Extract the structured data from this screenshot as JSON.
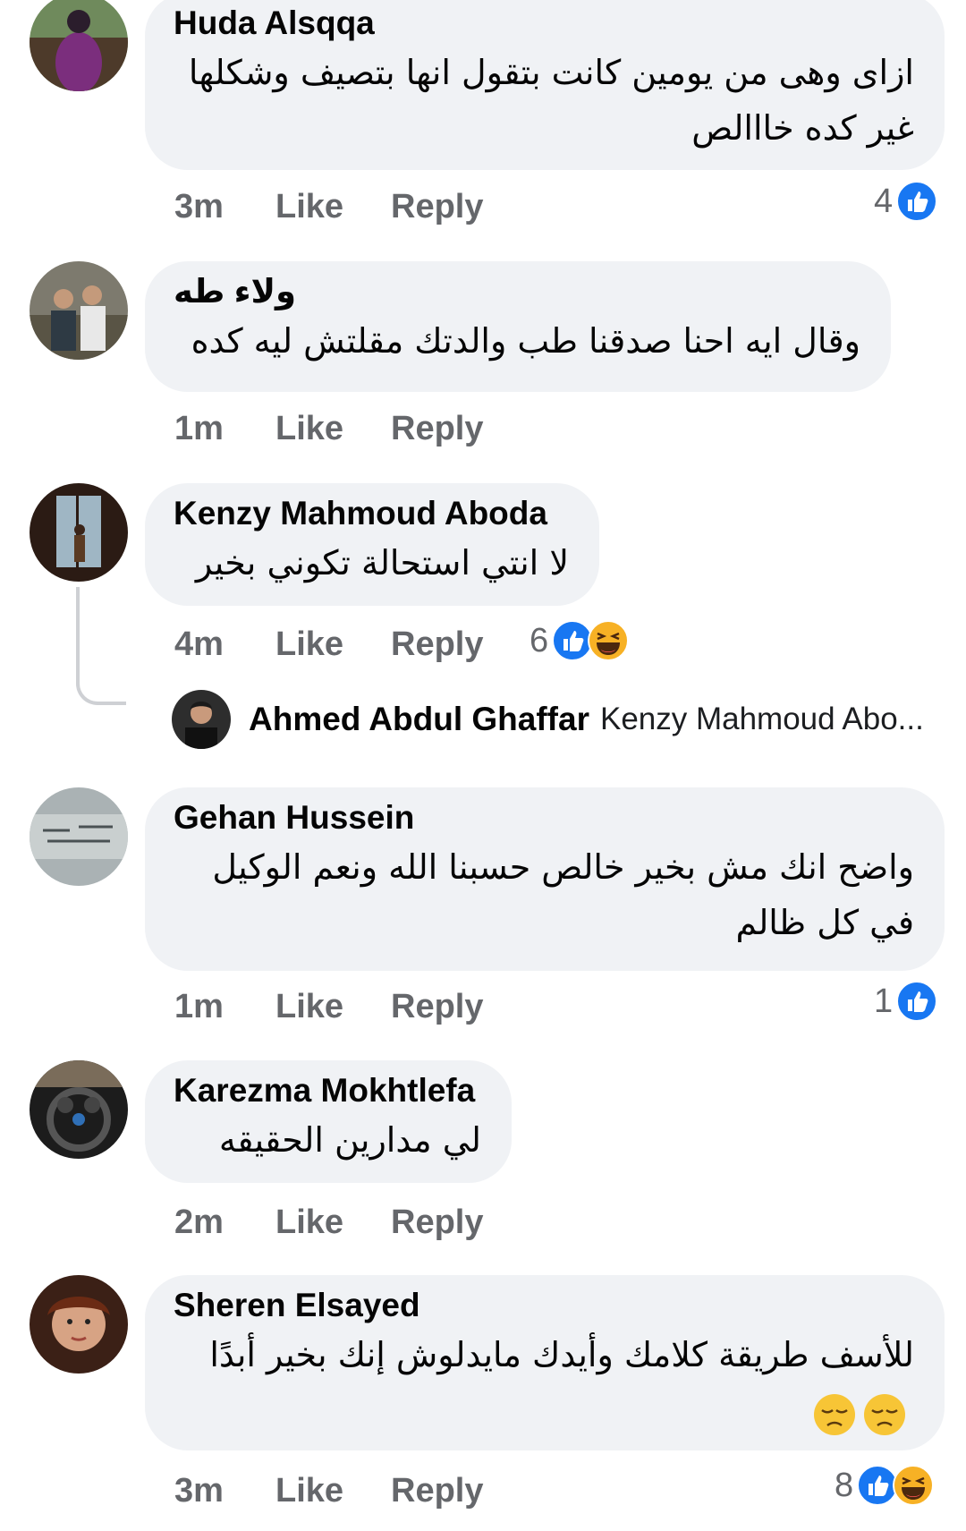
{
  "ui": {
    "like_label": "Like",
    "reply_label": "Reply"
  },
  "colors": {
    "like_blue": "#1877f2",
    "bubble_bg": "#f0f2f5",
    "meta_gray": "#65676b",
    "haha_yellow": "#f7b125"
  },
  "comments": [
    {
      "author": "Huda Alsqqa",
      "text": "ازاى وهى من يومين كانت بتقول انها بتصيف وشكلها\nغير كده خااالص",
      "time": "3m",
      "reactions": {
        "count": "4",
        "types": [
          "like-icon"
        ]
      }
    },
    {
      "author": "ولاء طه",
      "text": "وقال ايه احنا صدقنا طب والدتك مقلتش ليه كده",
      "time": "1m",
      "reactions": null
    },
    {
      "author": "Kenzy Mahmoud Aboda",
      "text": "لا انتي استحالة تكوني بخير",
      "time": "4m",
      "reactions": {
        "count": "6",
        "types": [
          "like-icon",
          "haha-icon"
        ]
      }
    },
    {
      "author": "Gehan Hussein",
      "text": "واضح انك مش بخير خالص حسبنا الله ونعم الوكيل\nفي كل ظالم",
      "time": "1m",
      "reactions": {
        "count": "1",
        "types": [
          "like-icon"
        ]
      }
    },
    {
      "author": "Karezma Mokhtlefa",
      "text": "لي مدارين الحقيقه",
      "time": "2m",
      "reactions": null
    },
    {
      "author": "Sheren Elsayed",
      "text": "للأسف طريقة كلامك وأيدك مايدلوش إنك بخير أبدًا",
      "emojis": [
        "sad-face-emoji",
        "sad-face-emoji"
      ],
      "time": "3m",
      "reactions": {
        "count": "8",
        "types": [
          "like-icon",
          "haha-icon"
        ]
      }
    }
  ],
  "reply_preview": {
    "author": "Ahmed Abdul Ghaffar",
    "text": "Kenzy Mahmoud Abo..."
  }
}
